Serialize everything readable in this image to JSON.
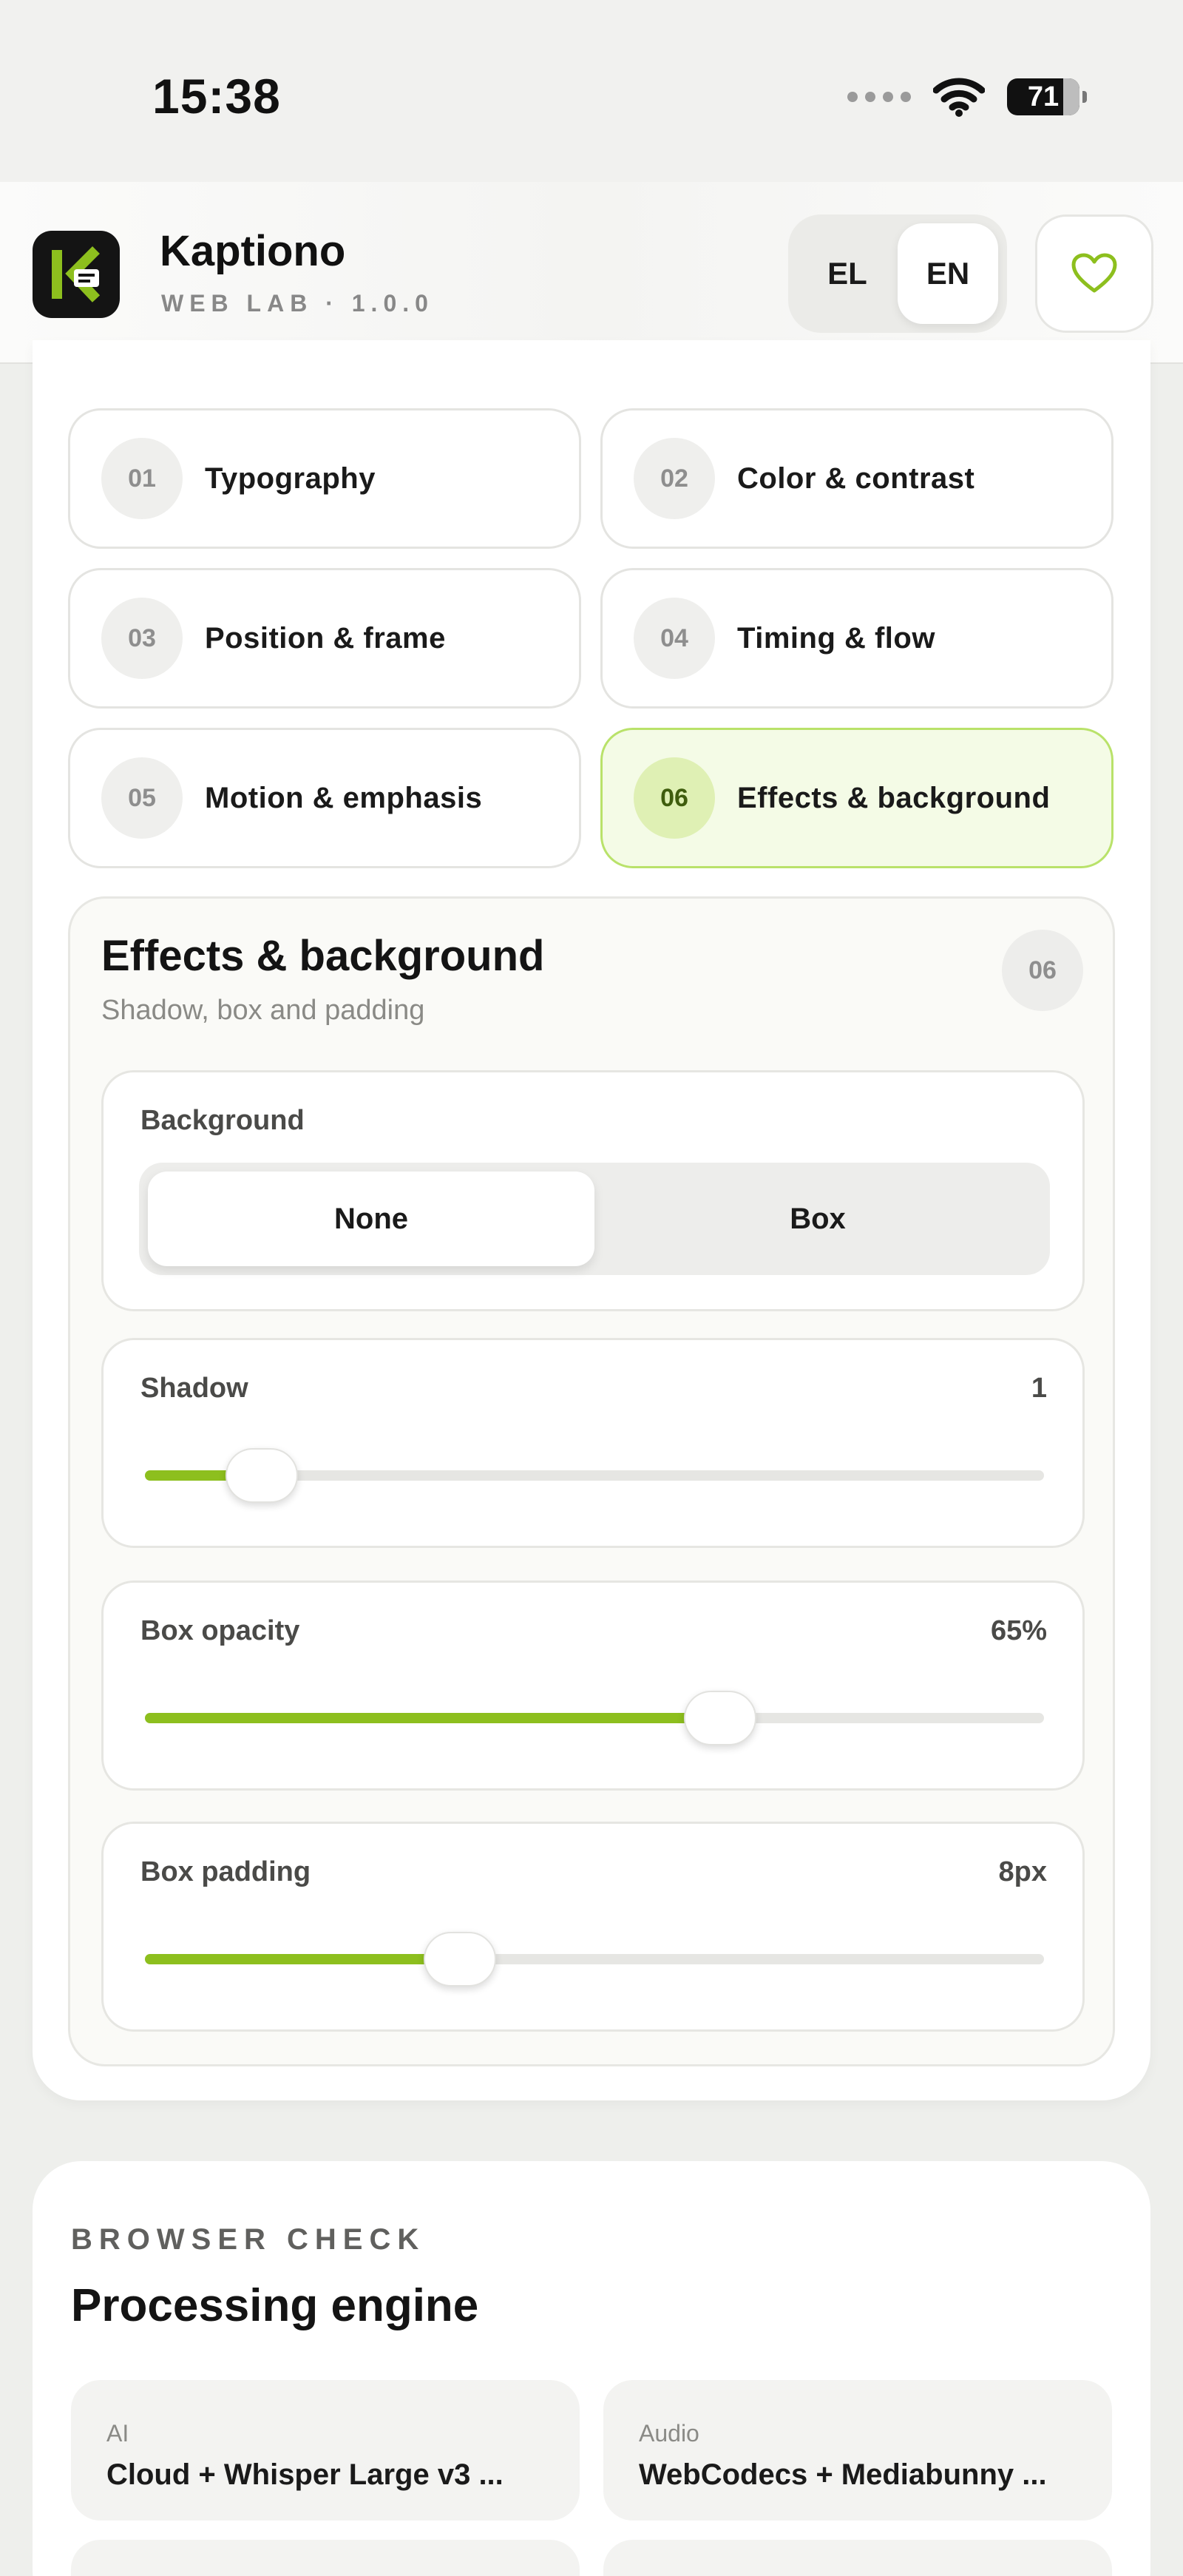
{
  "status_bar": {
    "time": "15:38",
    "battery": "71"
  },
  "app": {
    "name": "Kaptiono",
    "subtitle": "WEB LAB · 1.0.0"
  },
  "language": {
    "options": [
      "EL",
      "EN"
    ],
    "selected": "EN"
  },
  "favorite": {
    "icon": "heart-icon",
    "color": "#8dbf1e"
  },
  "nav": {
    "items": [
      {
        "num": "01",
        "label": "Typography"
      },
      {
        "num": "02",
        "label": "Color & contrast"
      },
      {
        "num": "03",
        "label": "Position & frame"
      },
      {
        "num": "04",
        "label": "Timing & flow"
      },
      {
        "num": "05",
        "label": "Motion & emphasis"
      },
      {
        "num": "06",
        "label": "Effects & background",
        "active": true
      }
    ]
  },
  "section": {
    "title": "Effects & background",
    "subtitle": "Shadow, box and padding",
    "badge": "06",
    "background": {
      "label": "Background",
      "options": [
        "None",
        "Box"
      ],
      "selected": "None"
    },
    "shadow": {
      "label": "Shadow",
      "value": "1",
      "level": 0.13
    },
    "box_opacity": {
      "label": "Box opacity",
      "value": "65%",
      "level": 0.64
    },
    "box_padding": {
      "label": "Box padding",
      "value": "8px",
      "level": 0.35
    }
  },
  "browser_check": {
    "kicker": "BROWSER CHECK",
    "title": "Processing engine",
    "tiles": [
      {
        "label": "AI",
        "value": "Cloud + Whisper Large v3 ..."
      },
      {
        "label": "Audio",
        "value": "WebCodecs + Mediabunny ..."
      }
    ]
  },
  "colors": {
    "accent": "#8dbf1e",
    "active_bg": "#f4fbe6",
    "active_border": "#b9e26a"
  }
}
